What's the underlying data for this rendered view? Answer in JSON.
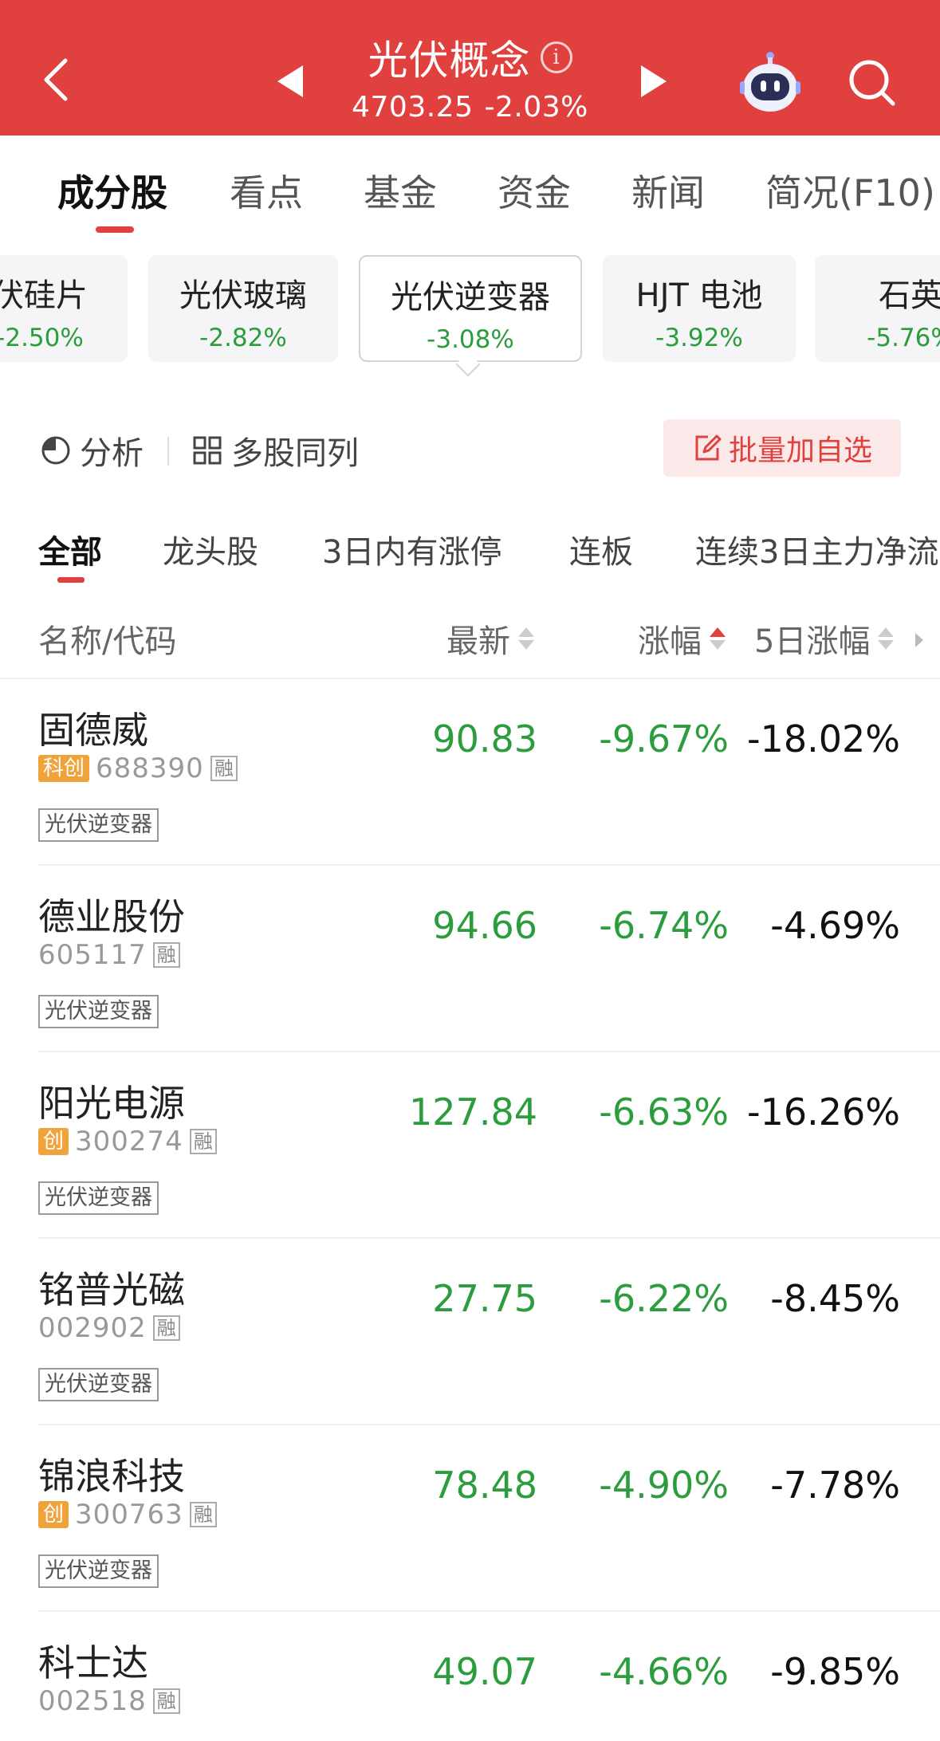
{
  "header": {
    "title": "光伏概念",
    "info_icon": "i",
    "index_value": "4703.25",
    "index_change": "-2.03%",
    "colors": {
      "bar": "#e0413f",
      "down_green": "#2b9d3d",
      "accent_red": "#e0413f"
    }
  },
  "main_tabs": [
    {
      "label": "成分股",
      "active": true
    },
    {
      "label": "看点"
    },
    {
      "label": "基金"
    },
    {
      "label": "资金"
    },
    {
      "label": "新闻"
    },
    {
      "label": "简况(F10)"
    }
  ],
  "chips": [
    {
      "name": "伏硅片",
      "pct": "-2.50%"
    },
    {
      "name": "光伏玻璃",
      "pct": "-2.82%"
    },
    {
      "name": "光伏逆变器",
      "pct": "-3.08%",
      "active": true
    },
    {
      "name": "HJT 电池",
      "pct": "-3.92%"
    },
    {
      "name": "石英",
      "pct": "-5.76%"
    }
  ],
  "tools": {
    "analysis": "分析",
    "multi": "多股同列",
    "batch_add": "批量加自选"
  },
  "filters": [
    {
      "label": "全部",
      "active": true
    },
    {
      "label": "龙头股"
    },
    {
      "label": "3日内有涨停"
    },
    {
      "label": "连板"
    },
    {
      "label": "连续3日主力净流"
    }
  ],
  "columns": {
    "name": "名称/代码",
    "latest": "最新",
    "change": "涨幅",
    "change5": "5日涨幅"
  },
  "stocks": [
    {
      "name": "固德威",
      "board": "科创",
      "code": "688390",
      "rong": "融",
      "tag": "光伏逆变器",
      "price": "90.83",
      "change": "-9.67%",
      "change5": "-18.02%"
    },
    {
      "name": "德业股份",
      "board": "",
      "code": "605117",
      "rong": "融",
      "tag": "光伏逆变器",
      "price": "94.66",
      "change": "-6.74%",
      "change5": "-4.69%"
    },
    {
      "name": "阳光电源",
      "board": "创",
      "code": "300274",
      "rong": "融",
      "tag": "光伏逆变器",
      "price": "127.84",
      "change": "-6.63%",
      "change5": "-16.26%"
    },
    {
      "name": "铭普光磁",
      "board": "",
      "code": "002902",
      "rong": "融",
      "tag": "光伏逆变器",
      "price": "27.75",
      "change": "-6.22%",
      "change5": "-8.45%"
    },
    {
      "name": "锦浪科技",
      "board": "创",
      "code": "300763",
      "rong": "融",
      "tag": "光伏逆变器",
      "price": "78.48",
      "change": "-4.90%",
      "change5": "-7.78%"
    },
    {
      "name": "科士达",
      "board": "",
      "code": "002518",
      "rong": "融",
      "tag": "",
      "price": "49.07",
      "change": "-4.66%",
      "change5": "-9.85%"
    }
  ]
}
